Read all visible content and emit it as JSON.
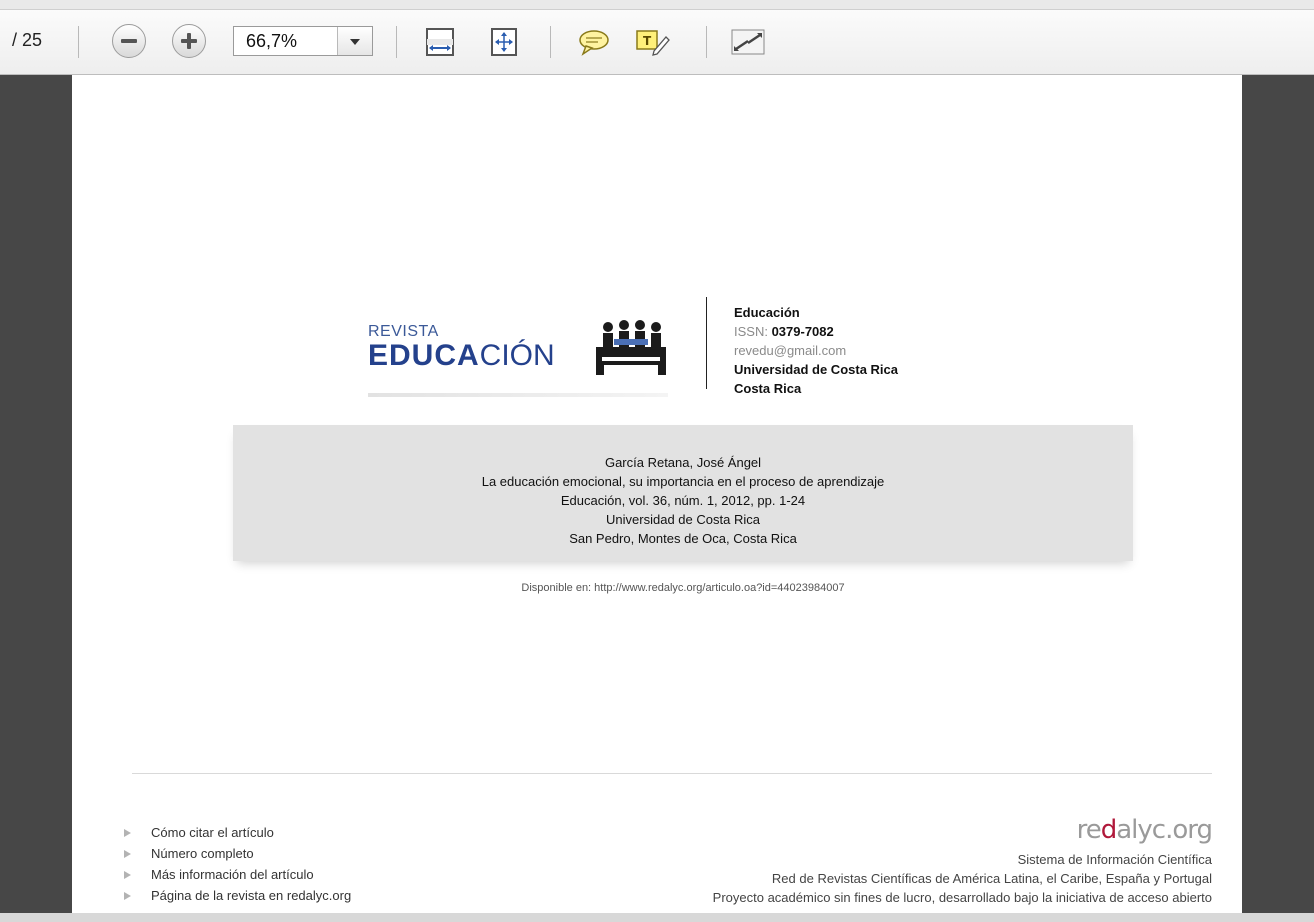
{
  "toolbar": {
    "page_count": "/ 25",
    "zoom_value": "66,7%"
  },
  "journal": {
    "logo_revista": "REVISTA",
    "logo_educa": "EDUCA",
    "logo_cion": "CIÓN",
    "name": "Educación",
    "issn_label": "ISSN: ",
    "issn": "0379-7082",
    "email": "revedu@gmail.com",
    "university": "Universidad de Costa Rica",
    "country": "Costa Rica"
  },
  "citation": {
    "author": "García Retana, José Ángel",
    "title": "La educación emocional, su importancia en el proceso de aprendizaje",
    "source": "Educación, vol. 36, núm. 1, 2012, pp. 1-24",
    "institution": "Universidad de Costa Rica",
    "location": "San Pedro, Montes de Oca, Costa Rica"
  },
  "available": "Disponible en: http://www.redalyc.org/articulo.oa?id=44023984007",
  "links": [
    {
      "label": "Cómo citar el artículo"
    },
    {
      "label": "Número completo"
    },
    {
      "label": "Más información del artículo"
    },
    {
      "label": "Página de la revista en redalyc.org"
    }
  ],
  "footer": {
    "brand_pre": "re",
    "brand_accent": "d",
    "brand_post": "alyc.org",
    "line1": "Sistema de Información Científica",
    "line2": "Red de Revistas Científicas de América Latina, el Caribe, España y Portugal",
    "line3": "Proyecto académico sin fines de lucro, desarrollado bajo la iniciativa de acceso abierto"
  },
  "colors": {
    "viewer_bg": "#474747",
    "page_bg": "#ffffff",
    "cite_box": "#e2e2e2",
    "brand_blue": "#24418c",
    "redalyc_red": "#b0183a"
  }
}
